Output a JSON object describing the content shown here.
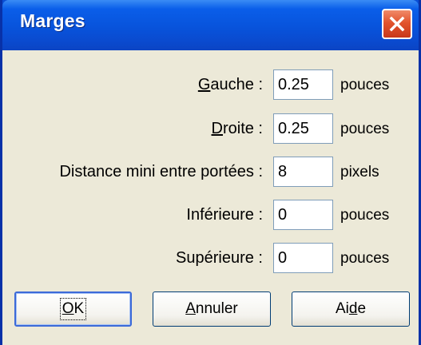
{
  "window": {
    "title": "Marges"
  },
  "colors": {
    "titlebar": "#0a5ee9",
    "close": "#e2542e",
    "dialog_bg": "#ece9d8"
  },
  "fields": [
    {
      "label_accel": "G",
      "label_rest": "auche :",
      "value": "0.25",
      "unit": "pouces"
    },
    {
      "label_accel": "D",
      "label_rest": "roite :",
      "value": "0.25",
      "unit": "pouces"
    },
    {
      "label_accel": "",
      "label_rest": "Distance mini entre portées :",
      "value": "8",
      "unit": "pixels"
    },
    {
      "label_accel": "",
      "label_rest": "Inférieure :",
      "value": "0",
      "unit": "pouces"
    },
    {
      "label_accel": "",
      "label_rest": "Supérieure :",
      "value": "0",
      "unit": "pouces"
    }
  ],
  "buttons": {
    "ok_accel": "O",
    "ok_rest": "K",
    "cancel_accel": "A",
    "cancel_rest": "nnuler",
    "help_pre": "Ai",
    "help_accel": "d",
    "help_post": "e"
  },
  "icons": {
    "close": "close-x-icon"
  }
}
